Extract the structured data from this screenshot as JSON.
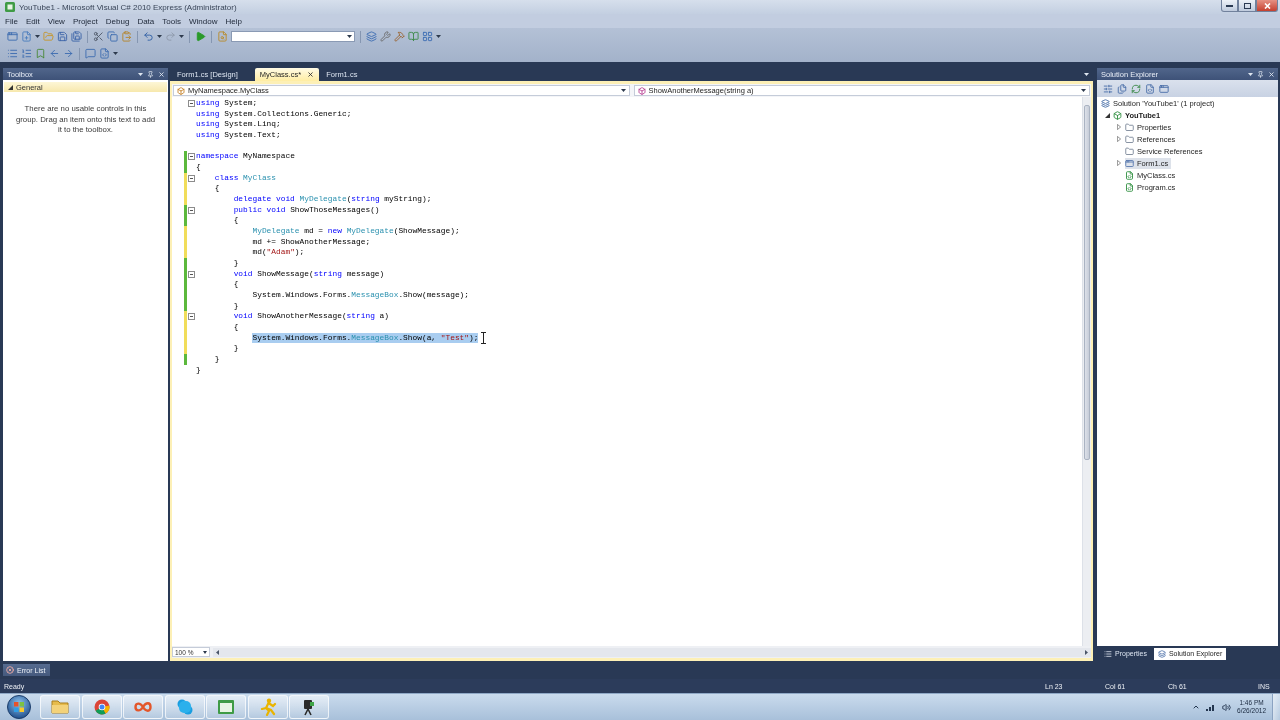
{
  "window": {
    "title": "YouTube1 - Microsoft Visual C# 2010 Express (Administrator)"
  },
  "menu": [
    "File",
    "Edit",
    "View",
    "Project",
    "Debug",
    "Data",
    "Tools",
    "Window",
    "Help"
  ],
  "toolbox": {
    "title": "Toolbox",
    "group": {
      "label": "General",
      "expanded": true
    },
    "message": "There are no usable controls in this group. Drag an item onto this text to add it to the toolbox."
  },
  "document_tabs": [
    {
      "label": "Form1.cs [Design]",
      "selected": false
    },
    {
      "label": "MyClass.cs*",
      "selected": true
    },
    {
      "label": "Form1.cs",
      "selected": false
    }
  ],
  "navigation": {
    "type_dropdown": "MyNamespace.MyClass",
    "member_dropdown": "ShowAnotherMessage(string a)"
  },
  "code": {
    "lines": [
      {
        "tokens": [
          {
            "kind": "keyword",
            "text": "using"
          },
          {
            "kind": "plain",
            "text": " System;"
          }
        ],
        "foldable": true,
        "selected": false
      },
      {
        "tokens": [
          {
            "kind": "keyword",
            "text": "using"
          },
          {
            "kind": "plain",
            "text": " System.Collections.Generic;"
          }
        ],
        "foldable": false,
        "selected": false
      },
      {
        "tokens": [
          {
            "kind": "keyword",
            "text": "using"
          },
          {
            "kind": "plain",
            "text": " System.Linq;"
          }
        ],
        "foldable": false,
        "selected": false
      },
      {
        "tokens": [
          {
            "kind": "keyword",
            "text": "using"
          },
          {
            "kind": "plain",
            "text": " System.Text;"
          }
        ],
        "foldable": false,
        "selected": false
      },
      {
        "foldable": false
      },
      {
        "tokens": [
          {
            "kind": "keyword",
            "text": "namespace"
          },
          {
            "kind": "plain",
            "text": " MyNamespace"
          }
        ],
        "color": "#5cb83c",
        "foldable": true,
        "selected": false
      },
      {
        "tokens": [
          {
            "kind": "plain",
            "text": "{"
          }
        ],
        "color": "#5cb83c",
        "foldable": false,
        "selected": false
      },
      {
        "tokens": [
          {
            "kind": "keyword",
            "text": "    class"
          },
          {
            "kind": "type",
            "text": " MyClass"
          }
        ],
        "color": "#f1dd5a",
        "foldable": true,
        "selected": false
      },
      {
        "tokens": [
          {
            "kind": "plain",
            "text": "    {"
          }
        ],
        "color": "#f1dd5a",
        "foldable": false,
        "selected": false
      },
      {
        "tokens": [
          {
            "kind": "keyword",
            "text": "        delegate"
          },
          {
            "kind": "keyword",
            "text": " void"
          },
          {
            "kind": "type",
            "text": " MyDelegate"
          },
          {
            "kind": "plain",
            "text": "("
          },
          {
            "kind": "keyword",
            "text": "string"
          },
          {
            "kind": "plain",
            "text": " myString);"
          }
        ],
        "color": "#f1dd5a",
        "foldable": false,
        "selected": false
      },
      {
        "tokens": [
          {
            "kind": "keyword",
            "text": "        public"
          },
          {
            "kind": "keyword",
            "text": " void"
          },
          {
            "kind": "plain",
            "text": " ShowThoseMessages()"
          }
        ],
        "color": "#5cb83c",
        "foldable": true,
        "selected": false
      },
      {
        "tokens": [
          {
            "kind": "plain",
            "text": "        {"
          }
        ],
        "color": "#5cb83c",
        "foldable": false,
        "selected": false
      },
      {
        "tokens": [
          {
            "kind": "type",
            "text": "            MyDelegate"
          },
          {
            "kind": "plain",
            "text": " md = "
          },
          {
            "kind": "keyword",
            "text": "new"
          },
          {
            "kind": "type",
            "text": " MyDelegate"
          },
          {
            "kind": "plain",
            "text": "(ShowMessage);"
          }
        ],
        "color": "#f1dd5a",
        "foldable": false,
        "selected": false
      },
      {
        "tokens": [
          {
            "kind": "plain",
            "text": "            md += ShowAnotherMessage;"
          }
        ],
        "color": "#f1dd5a",
        "foldable": false,
        "selected": false
      },
      {
        "tokens": [
          {
            "kind": "plain",
            "text": "            md("
          },
          {
            "kind": "string",
            "text": "\"Adam\""
          },
          {
            "kind": "plain",
            "text": ");"
          }
        ],
        "color": "#f1dd5a",
        "foldable": false,
        "selected": false
      },
      {
        "tokens": [
          {
            "kind": "plain",
            "text": "        }"
          }
        ],
        "color": "#5cb83c",
        "foldable": false,
        "selected": false
      },
      {
        "tokens": [
          {
            "kind": "keyword",
            "text": "        void"
          },
          {
            "kind": "plain",
            "text": " ShowMessage("
          },
          {
            "kind": "keyword",
            "text": "string"
          },
          {
            "kind": "plain",
            "text": " message)"
          }
        ],
        "color": "#5cb83c",
        "foldable": true,
        "selected": false
      },
      {
        "tokens": [
          {
            "kind": "plain",
            "text": "        {"
          }
        ],
        "color": "#5cb83c",
        "foldable": false,
        "selected": false
      },
      {
        "tokens": [
          {
            "kind": "plain",
            "text": "            System.Windows.Forms."
          },
          {
            "kind": "type",
            "text": "MessageBox"
          },
          {
            "kind": "plain",
            "text": ".Show(message);"
          }
        ],
        "color": "#5cb83c",
        "foldable": false,
        "selected": false
      },
      {
        "tokens": [
          {
            "kind": "plain",
            "text": "        }"
          }
        ],
        "color": "#5cb83c",
        "foldable": false,
        "selected": false
      },
      {
        "tokens": [
          {
            "kind": "keyword",
            "text": "        void"
          },
          {
            "kind": "plain",
            "text": " ShowAnotherMessage("
          },
          {
            "kind": "keyword",
            "text": "string"
          },
          {
            "kind": "plain",
            "text": " a)"
          }
        ],
        "color": "#f1dd5a",
        "foldable": true,
        "selected": false
      },
      {
        "tokens": [
          {
            "kind": "plain",
            "text": "        {"
          }
        ],
        "color": "#f1dd5a",
        "foldable": false,
        "selected": false
      },
      {
        "tokens": [
          {
            "kind": "plain",
            "text": "            System.Windows.Forms."
          },
          {
            "kind": "type",
            "text": "MessageBox"
          },
          {
            "kind": "plain",
            "text": ".Show(a, "
          },
          {
            "kind": "string",
            "text": "\"Test\""
          },
          {
            "kind": "plain",
            "text": ");"
          }
        ],
        "color": "#f1dd5a",
        "foldable": false,
        "selected": true
      },
      {
        "tokens": [
          {
            "kind": "plain",
            "text": "        }"
          }
        ],
        "color": "#f1dd5a",
        "foldable": false,
        "selected": false
      },
      {
        "tokens": [
          {
            "kind": "plain",
            "text": "    }"
          }
        ],
        "color": "#5cb83c",
        "foldable": false,
        "selected": false
      },
      {
        "tokens": [
          {
            "kind": "plain",
            "text": "}"
          }
        ],
        "foldable": false,
        "selected": false
      }
    ]
  },
  "zoom": "100 %",
  "solution_explorer": {
    "title": "Solution Explorer",
    "tree": [
      {
        "label": "Solution 'YouTube1' (1 project)",
        "kind": "solution",
        "selected": false,
        "children": [
          {
            "label": "YouTube1",
            "kind": "project",
            "expanded": true,
            "selected": false,
            "children": [
              {
                "label": "Properties",
                "kind": "folder",
                "expanded": false,
                "selected": false
              },
              {
                "label": "References",
                "kind": "references",
                "expanded": false,
                "selected": false
              },
              {
                "label": "Service References",
                "kind": "service",
                "selected": false
              },
              {
                "label": "Form1.cs",
                "kind": "form",
                "expanded": false,
                "selected": true
              },
              {
                "label": "MyClass.cs",
                "kind": "code",
                "selected": false
              },
              {
                "label": "Program.cs",
                "kind": "code",
                "selected": false
              }
            ]
          }
        ]
      }
    ]
  },
  "panel_tabs": [
    {
      "label": "Properties",
      "selected": false
    },
    {
      "label": "Solution Explorer",
      "selected": true
    }
  ],
  "bottom_tabs": [
    "Error List"
  ],
  "status_bar": {
    "message": "Ready",
    "line": "Ln 23",
    "column": "Col 61",
    "char": "Ch 61",
    "mode": "INS"
  },
  "taskbar": {
    "time": "1:46 PM",
    "date": "6/26/2012"
  }
}
